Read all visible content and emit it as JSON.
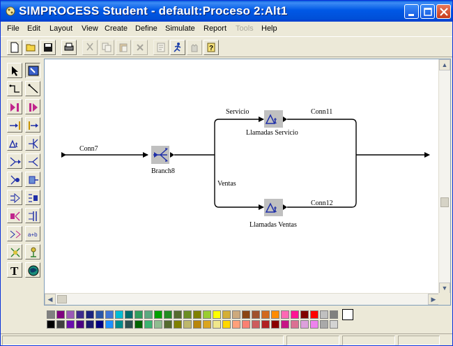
{
  "window": {
    "title": "SIMPROCESS Student - default:Proceso 2:Alt1"
  },
  "menu": {
    "items": [
      {
        "label": "File",
        "enabled": true
      },
      {
        "label": "Edit",
        "enabled": true
      },
      {
        "label": "Layout",
        "enabled": true
      },
      {
        "label": "View",
        "enabled": true
      },
      {
        "label": "Create",
        "enabled": true
      },
      {
        "label": "Define",
        "enabled": true
      },
      {
        "label": "Simulate",
        "enabled": true
      },
      {
        "label": "Report",
        "enabled": true
      },
      {
        "label": "Tools",
        "enabled": false
      },
      {
        "label": "Help",
        "enabled": true
      }
    ]
  },
  "toolbar": {
    "tools": [
      "new-file-icon",
      "open-folder-icon",
      "save-disk-icon",
      "print-icon",
      "cut-icon",
      "copy-icon",
      "paste-icon",
      "delete-icon",
      "properties-icon",
      "run-simulation-icon",
      "stop-simulation-icon",
      "help-icon"
    ]
  },
  "palette": {
    "tools": [
      "select-arrow-icon",
      "select-area-icon",
      "connector-bend-icon",
      "connector-straight-icon",
      "pad-left-icon",
      "pad-right-icon",
      "entry-icon",
      "exit-icon",
      "activity-delay-icon",
      "branch-icon",
      "merge-icon",
      "split-icon",
      "join-icon",
      "assign-icon",
      "transform-icon",
      "batch-icon",
      "unbatch-icon",
      "gate-icon",
      "synchronize-icon",
      "transfer-icon",
      "free-resource-icon",
      "get-resource-icon",
      "text-tool-icon",
      "globe-icon"
    ]
  },
  "diagram": {
    "nodes": [
      {
        "id": "branch",
        "label": "Branch8",
        "kind": "branch-icon"
      },
      {
        "id": "servicio",
        "label": "Llamadas Servicio",
        "kind": "delay-activity-icon"
      },
      {
        "id": "ventas",
        "label": "Llamadas Ventas",
        "kind": "delay-activity-icon"
      }
    ],
    "connectors": [
      {
        "label": "Conn7"
      },
      {
        "label": "Servicio"
      },
      {
        "label": "Ventas"
      },
      {
        "label": "Conn11"
      },
      {
        "label": "Conn12"
      }
    ],
    "activity_glyph": "Δt"
  },
  "colors": {
    "titlebar": "#0058e6",
    "window_bg": "#ece9d8",
    "canvas_bg": "#ffffff",
    "node_bg": "#c0c0c0",
    "node_icon": "#1f2fa8",
    "palette_row1": [
      "#808080",
      "#800080",
      "#9b59b6",
      "#3d2b8c",
      "#1a237e",
      "#2a56a8",
      "#3f76d6",
      "#00bcd4",
      "#006b6b",
      "#2e9d5c",
      "#5aa97f",
      "#00a000",
      "#228b22",
      "#556b2f",
      "#6b8e23",
      "#808000",
      "#9acd32",
      "#ffff00",
      "#d4af37",
      "#cdaa7d",
      "#8b4513",
      "#a0522d",
      "#d2691e",
      "#ff8c00",
      "#ff69b4",
      "#ff1493",
      "#800000",
      "#ff0000",
      "#c0c0c0",
      "#7f7f7f"
    ],
    "palette_row2": [
      "#000000",
      "#404040",
      "#6a0dad",
      "#4b0082",
      "#191970",
      "#000080",
      "#1e90ff",
      "#008b8b",
      "#2f4f4f",
      "#006400",
      "#3cb371",
      "#8fbc8f",
      "#556b2f",
      "#808000",
      "#bdb76b",
      "#b8860b",
      "#daa520",
      "#f0e68c",
      "#ffd700",
      "#ffa07a",
      "#fa8072",
      "#cd5c5c",
      "#b22222",
      "#8b0000",
      "#c71585",
      "#db7093",
      "#dda0dd",
      "#ee82ee",
      "#a9a9a9",
      "#d3d3d3"
    ],
    "current": "#ffffff"
  }
}
